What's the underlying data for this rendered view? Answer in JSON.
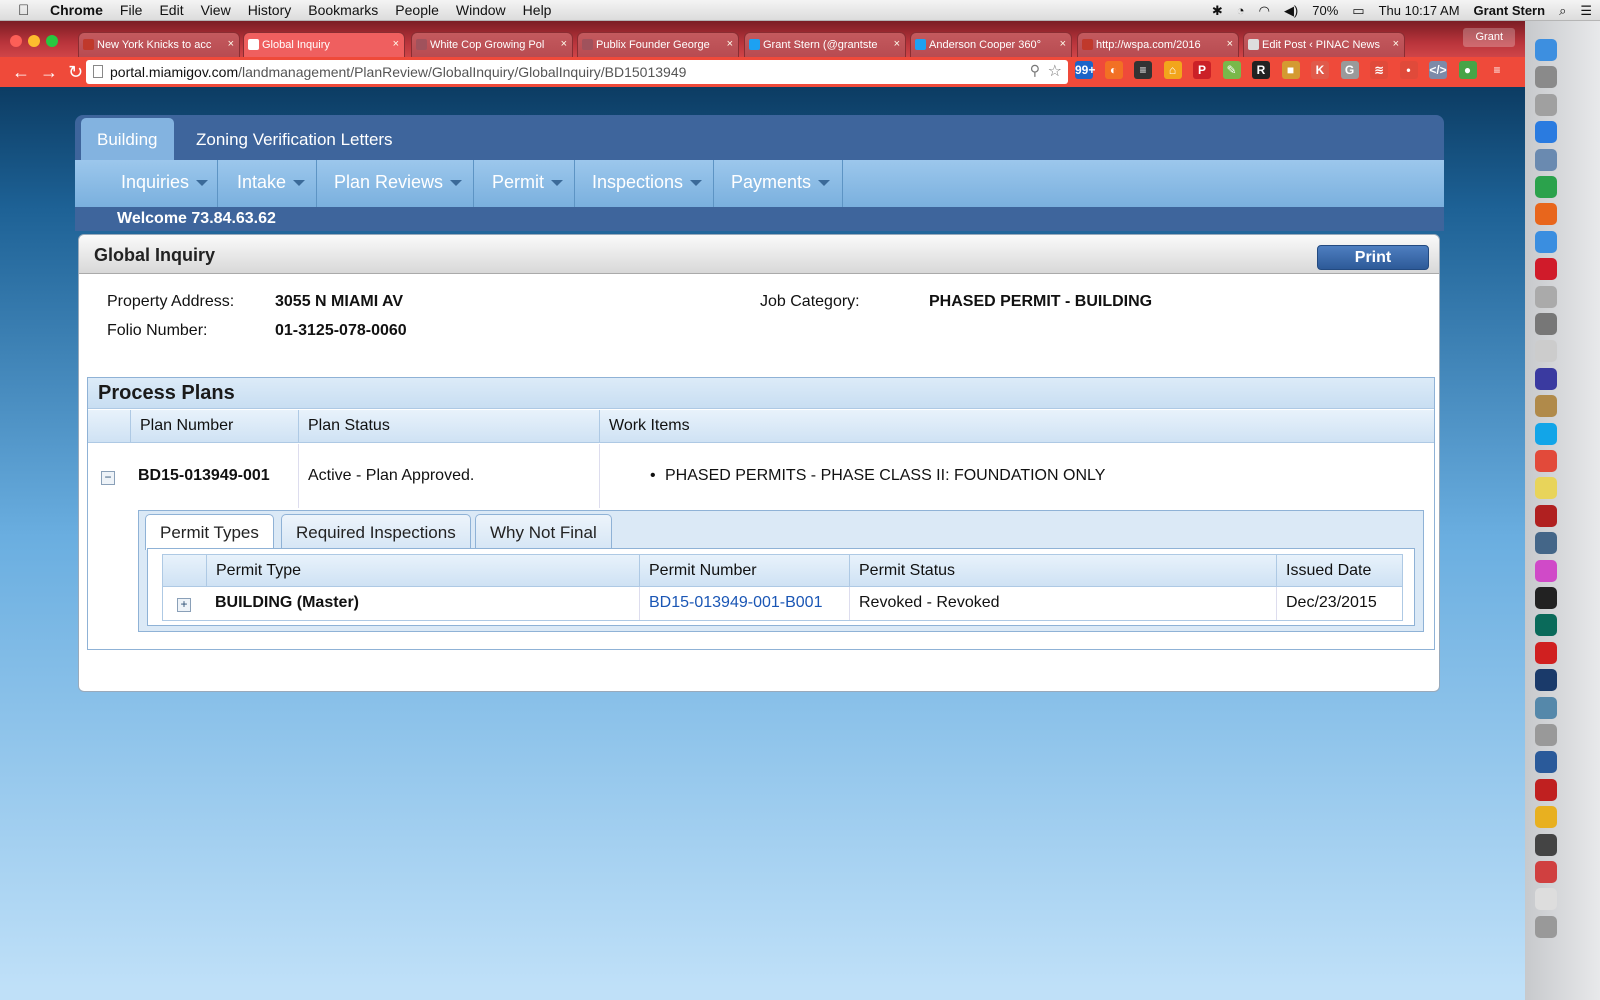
{
  "menubar": {
    "app": "Chrome",
    "items": [
      "File",
      "Edit",
      "View",
      "History",
      "Bookmarks",
      "People",
      "Window",
      "Help"
    ],
    "battery": "70%",
    "clock": "Thu 10:17 AM",
    "user": "Grant Stern"
  },
  "tabs": [
    {
      "title": "New York Knicks to acc",
      "icon": "page-icon",
      "color": "#c0392b"
    },
    {
      "title": "Global Inquiry",
      "icon": "globe-icon",
      "color": "#ffffff",
      "active": true
    },
    {
      "title": "White Cop Growing Pol",
      "icon": "page-icon",
      "color": "#a0525c"
    },
    {
      "title": "Publix Founder George",
      "icon": "page-icon",
      "color": "#a0525c"
    },
    {
      "title": "Grant Stern (@grantste",
      "icon": "twitter-icon",
      "color": "#1da1f2"
    },
    {
      "title": "Anderson Cooper 360°",
      "icon": "twitter-icon",
      "color": "#1da1f2"
    },
    {
      "title": "http://wspa.com/2016",
      "icon": "page-icon",
      "color": "#c0392b"
    },
    {
      "title": "Edit Post ‹ PINAC News",
      "icon": "page-icon",
      "color": "#dddddd"
    }
  ],
  "profile": "Grant",
  "url": {
    "host": "portal.miamigov.com",
    "path": "/landmanagement/PlanReview/GlobalInquiry/GlobalInquiry/BD15013949"
  },
  "extensions": [
    {
      "label": "99+",
      "color": "#1c64c8"
    },
    {
      "label": "◐",
      "color": "#f27024"
    },
    {
      "label": "≡",
      "color": "#333333"
    },
    {
      "label": "⌂",
      "color": "#f2a51c"
    },
    {
      "label": "P",
      "color": "#cb2027"
    },
    {
      "label": "✎",
      "color": "#79b84a"
    },
    {
      "label": "R",
      "color": "#222222"
    },
    {
      "label": "■",
      "color": "#d49a31"
    },
    {
      "label": "K",
      "color": "#e05a4a"
    },
    {
      "label": "G",
      "color": "#9a9a9a"
    },
    {
      "label": "≋",
      "color": "#e04a3a"
    },
    {
      "label": "•",
      "color": "#e04a3a"
    },
    {
      "label": "</>",
      "color": "#7d8aa8"
    },
    {
      "label": "●",
      "color": "#47a447"
    },
    {
      "label": "≡",
      "color": "#ef4a3a"
    }
  ],
  "site": {
    "top_tabs": [
      "Building",
      "Zoning Verification Letters"
    ],
    "menu": [
      "Inquiries",
      "Intake",
      "Plan Reviews",
      "Permit",
      "Inspections",
      "Payments"
    ],
    "welcome": "Welcome 73.84.63.62",
    "title": "Global Inquiry",
    "print": "Print",
    "property_address_label": "Property Address:",
    "property_address": "3055 N MIAMI AV",
    "folio_label": "Folio Number:",
    "folio": "01-3125-078-0060",
    "job_category_label": "Job Category:",
    "job_category": "PHASED PERMIT - BUILDING"
  },
  "process_plans": {
    "title": "Process Plans",
    "headers": [
      "Plan Number",
      "Plan Status",
      "Work Items"
    ],
    "row": {
      "plan_number": "BD15-013949-001",
      "plan_status": "Active - Plan Approved.",
      "work_item": "PHASED PERMITS - PHASE CLASS II: FOUNDATION ONLY"
    },
    "inner_tabs": [
      "Permit Types",
      "Required Inspections",
      "Why Not Final"
    ],
    "permit_headers": [
      "Permit Type",
      "Permit Number",
      "Permit Status",
      "Issued Date"
    ],
    "permit_row": {
      "type": "BUILDING (Master)",
      "number": "BD15-013949-001-B001",
      "status": "Revoked - Revoked",
      "issued": "Dec/23/2015"
    }
  },
  "dock": [
    {
      "icon": "finder-icon",
      "color": "#3d8fe0"
    },
    {
      "icon": "rocket-icon",
      "color": "#8a8a8a"
    },
    {
      "icon": "calculator-icon",
      "color": "#a0a0a0"
    },
    {
      "icon": "app-store-icon",
      "color": "#2a7be0"
    },
    {
      "icon": "preview-icon",
      "color": "#6a8ab0"
    },
    {
      "icon": "chrome-icon",
      "color": "#2ba24c"
    },
    {
      "icon": "firefox-icon",
      "color": "#e8661c"
    },
    {
      "icon": "safari-icon",
      "color": "#3a8ee0"
    },
    {
      "icon": "opera-icon",
      "color": "#d01b2a"
    },
    {
      "icon": "launchpad-icon",
      "color": "#aaaaaa"
    },
    {
      "icon": "photo-icon",
      "color": "#777777"
    },
    {
      "icon": "textedit-icon",
      "color": "#cccccc"
    },
    {
      "icon": "star-icon",
      "color": "#3a3aa0"
    },
    {
      "icon": "contacts-icon",
      "color": "#b08a4a"
    },
    {
      "icon": "skype-icon",
      "color": "#12a5e8"
    },
    {
      "icon": "calendar-icon",
      "color": "#e24a3a"
    },
    {
      "icon": "notes-icon",
      "color": "#e8d45a"
    },
    {
      "icon": "photo-booth-icon",
      "color": "#b02020"
    },
    {
      "icon": "image-capture-icon",
      "color": "#446688"
    },
    {
      "icon": "itunes-icon",
      "color": "#d04ac8"
    },
    {
      "icon": "terminal-icon",
      "color": "#222222"
    },
    {
      "icon": "audition-icon",
      "color": "#0a6a5a"
    },
    {
      "icon": "acrobat-icon",
      "color": "#d02020"
    },
    {
      "icon": "photoshop-icon",
      "color": "#1a3a6a"
    },
    {
      "icon": "dashboard-icon",
      "color": "#5588aa"
    },
    {
      "icon": "keychain-icon",
      "color": "#999999"
    },
    {
      "icon": "quicktime-icon",
      "color": "#2a5a9a"
    },
    {
      "icon": "download-icon",
      "color": "#c02020"
    },
    {
      "icon": "ring-icon",
      "color": "#e8b020"
    },
    {
      "icon": "drive-icon",
      "color": "#444444"
    },
    {
      "icon": "screen-icon",
      "color": "#d04040"
    },
    {
      "icon": "document-icon",
      "color": "#dddddd"
    },
    {
      "icon": "trash-icon",
      "color": "#999999"
    }
  ]
}
